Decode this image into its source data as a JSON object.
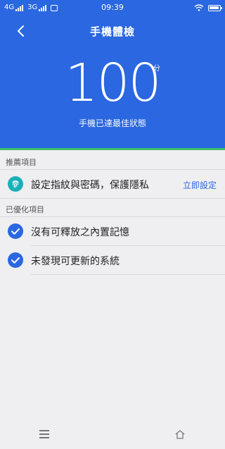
{
  "status": {
    "net1": "4G",
    "net2": "3G",
    "time": "09:39"
  },
  "header": {
    "title": "手機體檢",
    "back_icon": "chevron-left-icon"
  },
  "score": {
    "value": "100",
    "unit": "分",
    "subtitle": "手機已達最佳狀態"
  },
  "recommend": {
    "label": "推薦項目",
    "items": [
      {
        "text": "設定指紋與密碼，保護隱私",
        "action": "立即設定",
        "icon": "fingerprint-icon"
      }
    ]
  },
  "optimized": {
    "label": "已優化項目",
    "items": [
      {
        "text": "沒有可釋放之內置記憶",
        "icon": "check-circle-icon"
      },
      {
        "text": "未發現可更新的系統",
        "icon": "check-circle-icon"
      }
    ]
  },
  "colors": {
    "header_bg": "#2a67e0",
    "accent_green": "#3fc06a",
    "link": "#2a67e0",
    "check": "#2a67e0",
    "fingerprint": "#1ab0b8",
    "page_bg": "#efeff1"
  }
}
